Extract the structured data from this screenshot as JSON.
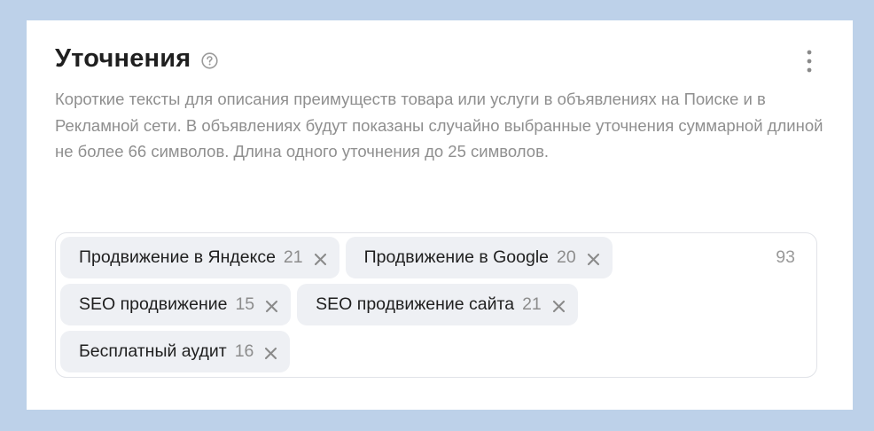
{
  "section": {
    "title": "Уточнения",
    "help_icon": "question-circle-icon",
    "menu_icon": "more-vertical-icon",
    "description": "Короткие тексты для описания преимуществ товара или услуги в объявлениях на Поиске и в Рекламной сети. В объявлениях будут показаны случайно выбранные уточнения суммарной длиной не более 66 символов. Длина одного уточнения до 25 символов."
  },
  "tags": {
    "total": "93",
    "items": [
      {
        "label": "Продвижение в Яндексе",
        "count": "21"
      },
      {
        "label": "Продвижение в Google",
        "count": "20"
      },
      {
        "label": "SEO продвижение",
        "count": "15"
      },
      {
        "label": "SEO продвижение сайта",
        "count": "21"
      },
      {
        "label": "Бесплатный аудит",
        "count": "16"
      }
    ],
    "remove_icon": "close-icon"
  },
  "colors": {
    "background": "#bdd1e9",
    "card": "#ffffff",
    "tag_background": "#eef0f4",
    "muted_text": "#8f8f8f"
  }
}
